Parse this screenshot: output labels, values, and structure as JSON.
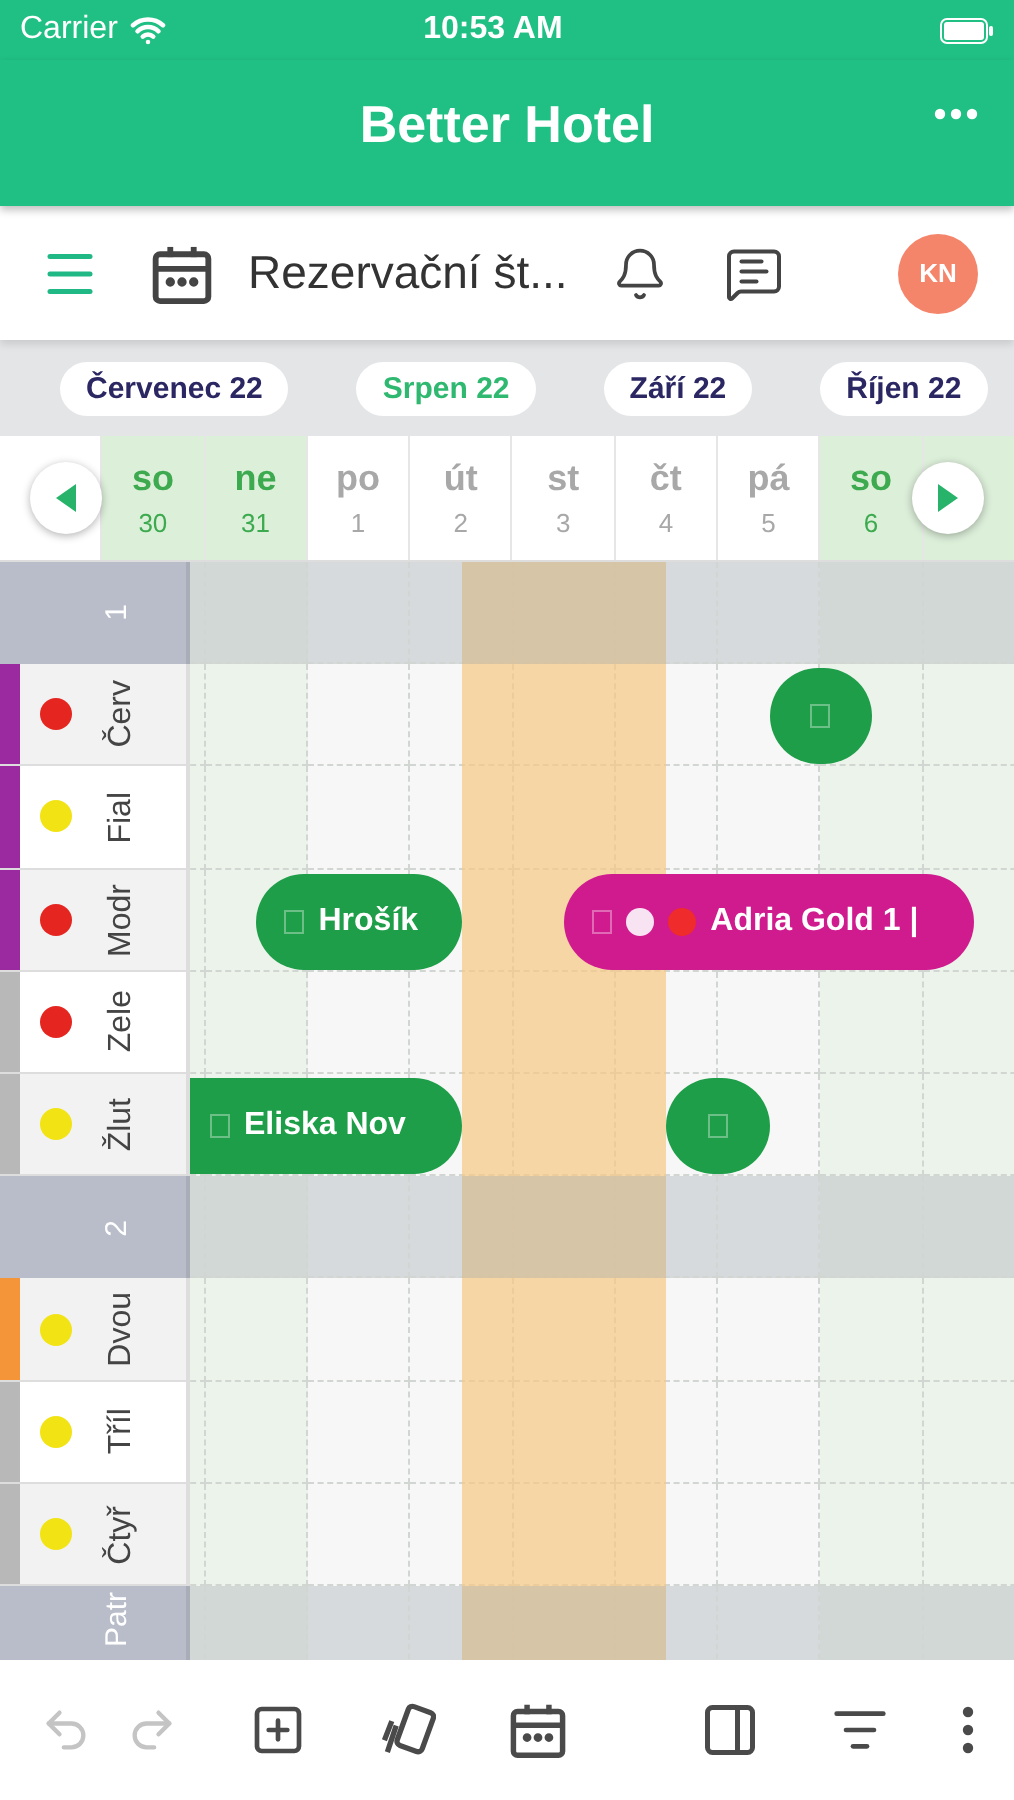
{
  "status_bar": {
    "carrier": "Carrier",
    "time": "10:53 AM"
  },
  "header": {
    "title": "Better Hotel"
  },
  "toolbar": {
    "title": "Rezervační št...",
    "avatar": "KN"
  },
  "months": [
    {
      "label": "Červenec 22",
      "selected": false
    },
    {
      "label": "Srpen 22",
      "selected": true
    },
    {
      "label": "Září 22",
      "selected": false
    },
    {
      "label": "Říjen 22",
      "selected": false
    }
  ],
  "days": [
    {
      "kind": "edge",
      "weekend": false
    },
    {
      "kind": "day",
      "weekday": "so",
      "day": "30",
      "weekend": true
    },
    {
      "kind": "day",
      "weekday": "ne",
      "day": "31",
      "weekend": true
    },
    {
      "kind": "day",
      "weekday": "po",
      "day": "1",
      "weekend": false
    },
    {
      "kind": "day",
      "weekday": "út",
      "day": "2",
      "weekend": false
    },
    {
      "kind": "day",
      "weekday": "st",
      "day": "3",
      "weekend": false
    },
    {
      "kind": "day",
      "weekday": "čt",
      "day": "4",
      "weekend": false
    },
    {
      "kind": "day",
      "weekday": "pá",
      "day": "5",
      "weekend": false
    },
    {
      "kind": "day",
      "weekday": "so",
      "day": "6",
      "weekend": true
    },
    {
      "kind": "edge",
      "weekend": true
    }
  ],
  "groups": [
    {
      "label": "1",
      "rooms": [
        {
          "name": "Červ",
          "color": "#e52620",
          "type": {
            "color": "#9b2aa0"
          },
          "bookings": [
            {
              "color": "#1e9e48"
            }
          ]
        },
        {
          "name": "Fial",
          "color": "#f2e315",
          "type": {
            "color": "#9b2aa0"
          }
        },
        {
          "name": "Modr",
          "color": "#e52620",
          "type": {
            "color": "#9b2aa0"
          },
          "bookings": [
            {
              "label": "Hrošík",
              "color": "#1e9e48"
            },
            {
              "label": "Adria Gold 1 |",
              "color": "#d01b8f",
              "markers": [
                {
                  "color": "#f8e3f3"
                },
                {
                  "color": "#ef2b2b"
                }
              ]
            }
          ]
        },
        {
          "name": "Zele",
          "color": "#e52620",
          "type": {
            "color": "#b8b8b8"
          }
        },
        {
          "name": "Žlut",
          "color": "#f2e315",
          "type": {
            "color": "#b8b8b8"
          },
          "bookings": [
            {
              "label": "Eliska Nov",
              "color": "#1e9e48"
            },
            {
              "color": "#1e9e48"
            }
          ]
        }
      ]
    },
    {
      "label": "2",
      "rooms": [
        {
          "name": "Dvou",
          "color": "#f2e315",
          "type": {
            "color": "#f5953a"
          }
        },
        {
          "name": "Tříl",
          "color": "#f2e315",
          "type": {
            "color": "#b8b8b8"
          }
        },
        {
          "name": "Čtyř",
          "color": "#f2e315",
          "type": {
            "color": "#b8b8b8"
          }
        }
      ]
    },
    {
      "label": "Patr"
    }
  ],
  "actions": [
    {
      "kind": "undo",
      "disabled": true
    },
    {
      "kind": "redo",
      "disabled": true
    },
    {
      "kind": "add",
      "disabled": false
    },
    {
      "kind": "cards",
      "disabled": false
    },
    {
      "kind": "calendar",
      "disabled": false
    },
    {
      "kind": "panel",
      "disabled": false
    },
    {
      "kind": "filter",
      "disabled": false
    },
    {
      "kind": "more",
      "disabled": false
    }
  ]
}
